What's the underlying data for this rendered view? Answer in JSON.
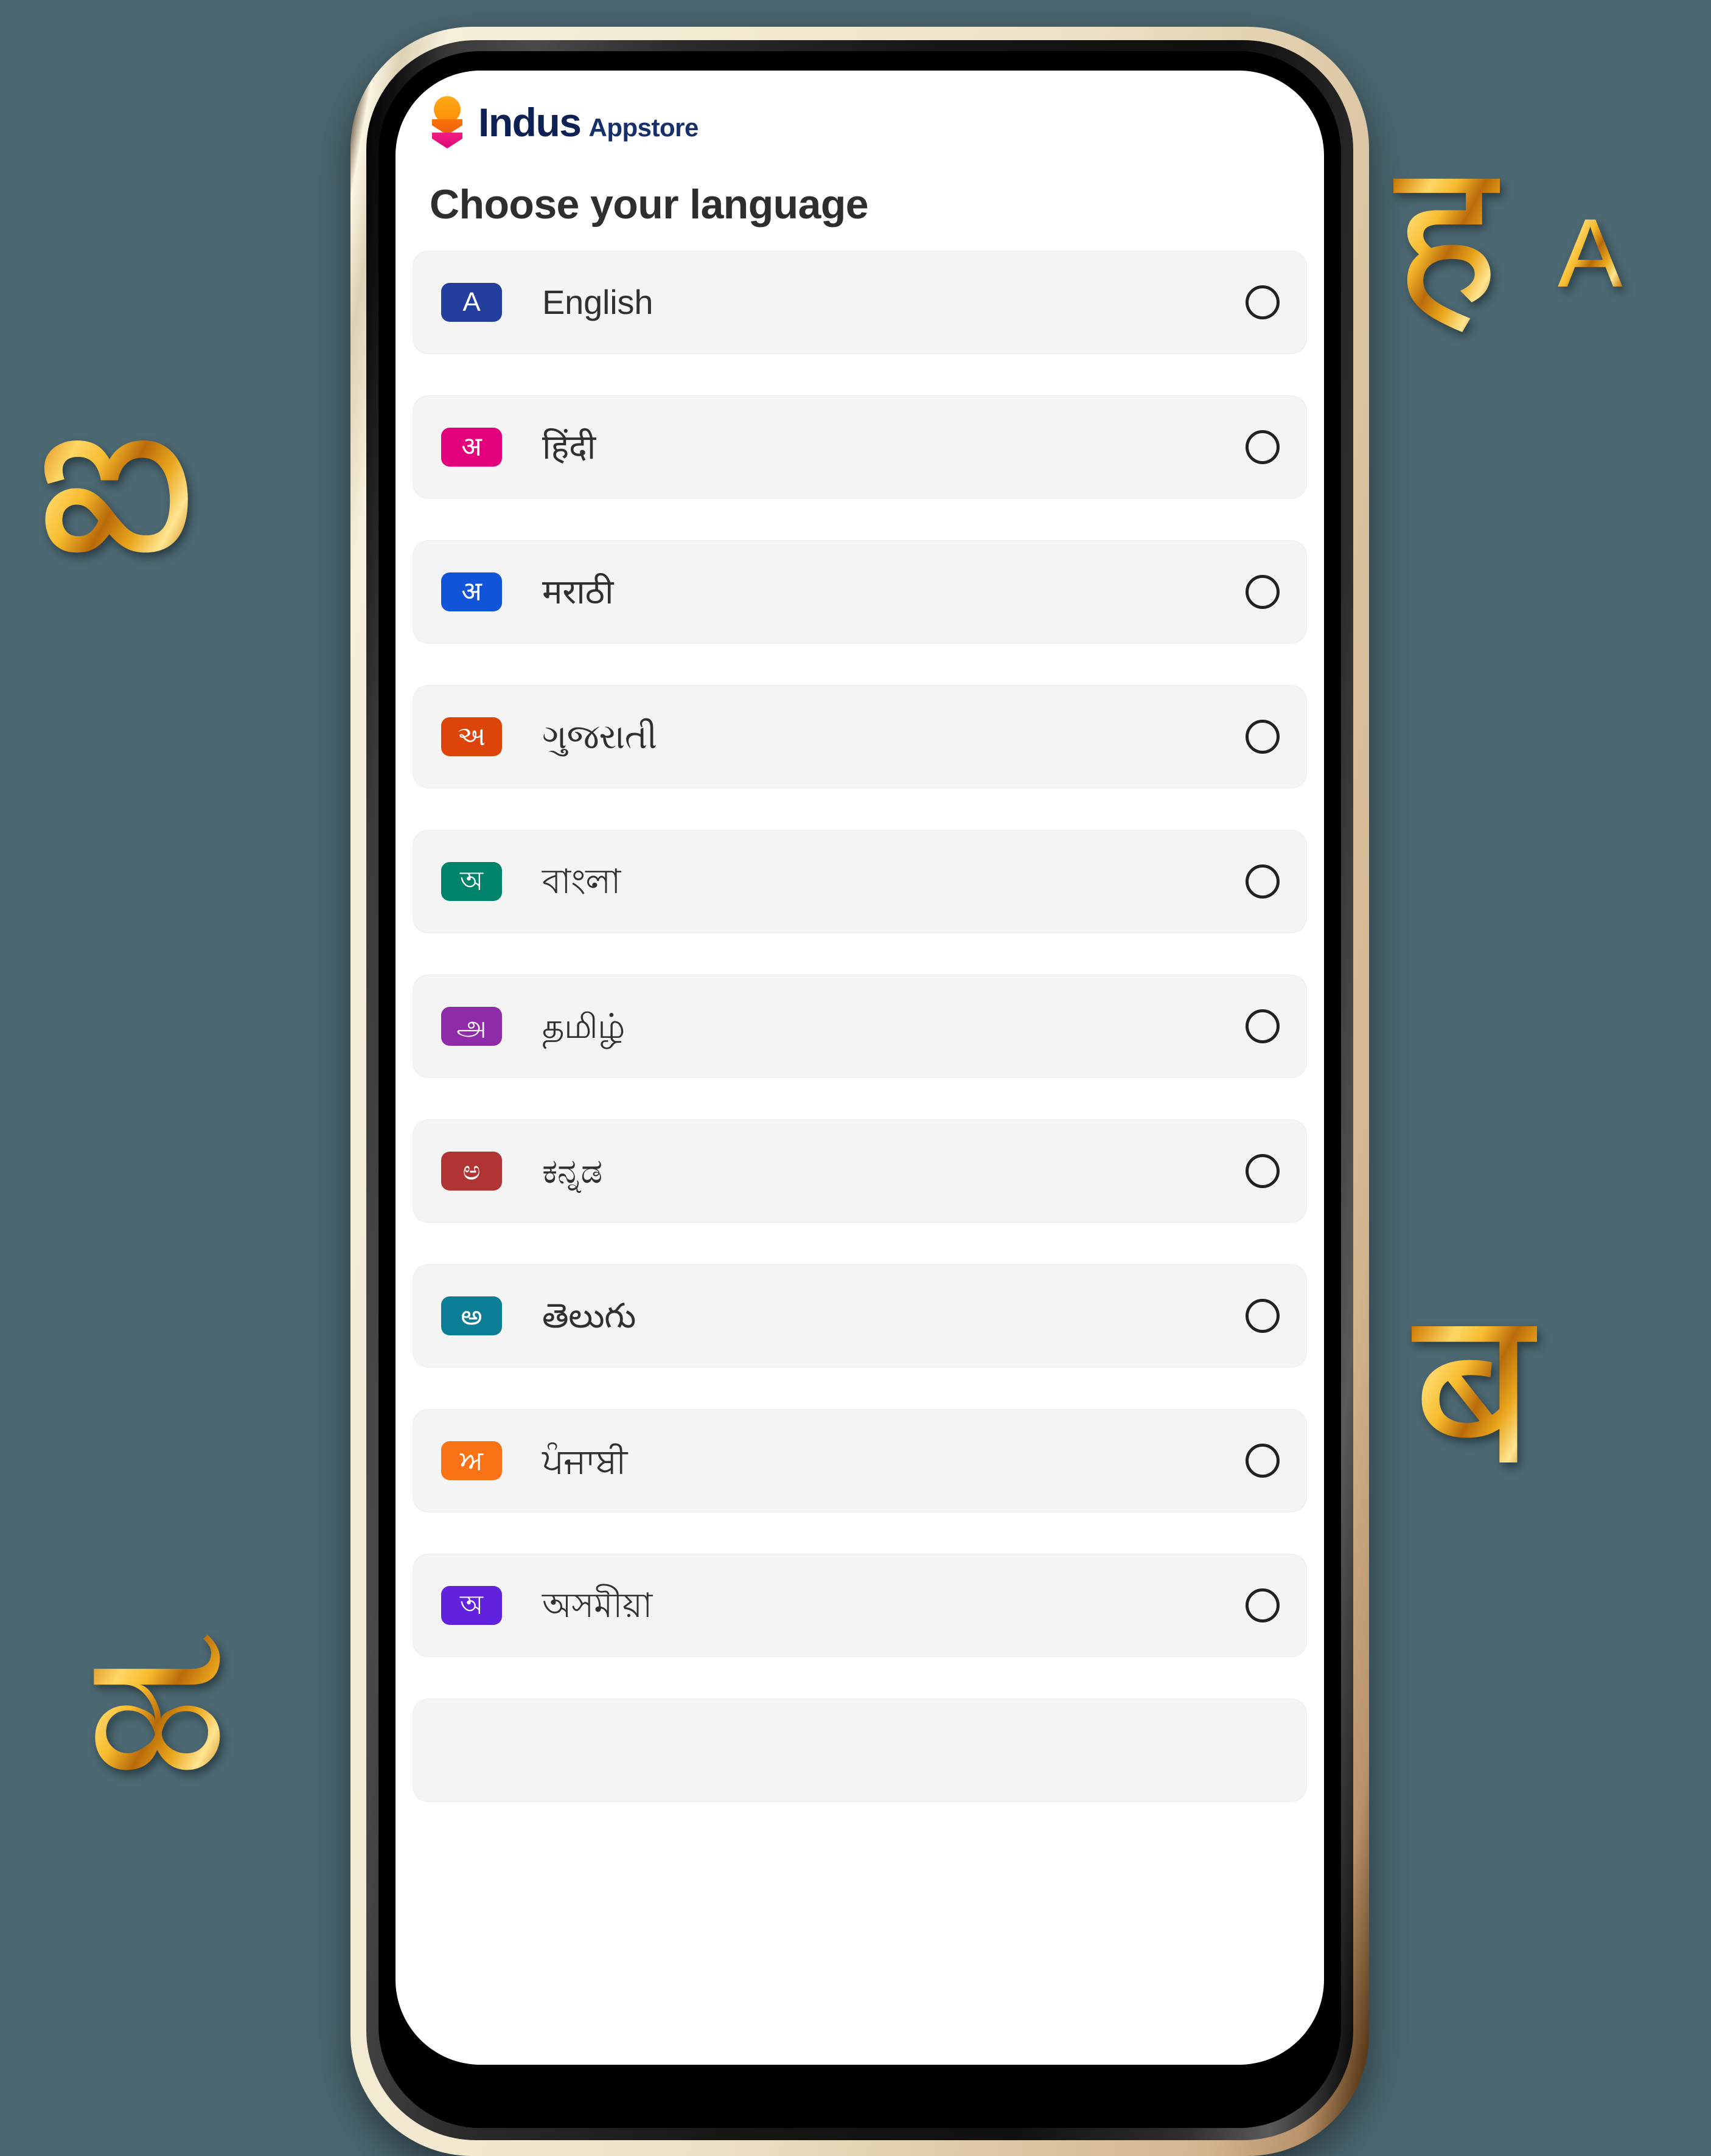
{
  "background_color": "#4c6872",
  "decorations": [
    {
      "name": "gold-letter-latin-a",
      "glyph": "A",
      "color": "#eaa61c"
    },
    {
      "name": "gold-letter-devanagari-ha",
      "glyph": "ह",
      "color": "#eaa61c"
    },
    {
      "name": "gold-letter-telugu-ai",
      "glyph": "ఐ",
      "color": "#eaa61c"
    },
    {
      "name": "gold-letter-devanagari-ba",
      "glyph": "ब",
      "color": "#eaa61c"
    },
    {
      "name": "gold-letter-kannada-ha",
      "glyph": "ಹ",
      "color": "#eaa61c"
    }
  ],
  "app": {
    "logo": {
      "brand": "Indus",
      "sub": "Appstore",
      "brand_color": "#0e2154",
      "mark_dot_color": "#fb8c08",
      "mark_chevron_top_color": "#f3650b",
      "mark_chevron_bottom_color": "#e4077b"
    },
    "page_title": "Choose your language",
    "languages": [
      {
        "badge": "A",
        "badge_color": "#243E9E",
        "label": "English",
        "selected": false
      },
      {
        "badge": "अ",
        "badge_color": "#E3007C",
        "label": "हिंदी",
        "selected": false
      },
      {
        "badge": "अ",
        "badge_color": "#1254D8",
        "label": "मराठी",
        "selected": false
      },
      {
        "badge": "અ",
        "badge_color": "#DD4409",
        "label": "ગુજરાતી",
        "selected": false
      },
      {
        "badge": "অ",
        "badge_color": "#00836B",
        "label": "বাংলা",
        "selected": false
      },
      {
        "badge": "அ",
        "badge_color": "#8E2BA8",
        "label": "தமிழ்",
        "selected": false
      },
      {
        "badge": "ಅ",
        "badge_color": "#B03434",
        "label": "ಕನ್ನಡ",
        "selected": false
      },
      {
        "badge": "అ",
        "badge_color": "#0B7E96",
        "label": "తెలుగు",
        "selected": false
      },
      {
        "badge": "ਅ",
        "badge_color": "#F97316",
        "label": "ਪੰਜਾਬੀ",
        "selected": false
      },
      {
        "badge": "অ",
        "badge_color": "#6022DD",
        "label": "অসমীয়া",
        "selected": false
      },
      {
        "badge": "",
        "badge_color": "#f4f4f4",
        "label": "",
        "selected": false
      }
    ]
  }
}
